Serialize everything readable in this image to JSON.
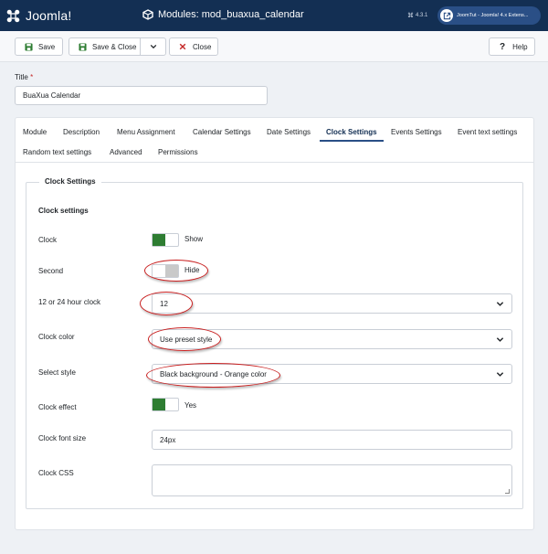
{
  "header": {
    "logo_text": "Joomla!",
    "page_title": "Modules: mod_buaxua_calendar",
    "version": "4.3.1",
    "version_symbol": "⌘",
    "site_link": "JoomTut - Joomla! 4.x Extens..."
  },
  "toolbar": {
    "save_label": "Save",
    "save_close_label": "Save & Close",
    "close_label": "Close",
    "help_label": "Help"
  },
  "title_field": {
    "label": "Title",
    "required_mark": "*",
    "value": "BuaXua Calendar"
  },
  "tabs": [
    "Module",
    "Description",
    "Menu Assignment",
    "Calendar Settings",
    "Date Settings",
    "Clock Settings",
    "Events Settings",
    "Event text settings",
    "Random text settings",
    "Advanced",
    "Permissions"
  ],
  "active_tab": "Clock Settings",
  "fieldset": {
    "legend": "Clock Settings",
    "heading": "Clock settings"
  },
  "fields": {
    "clock": {
      "label": "Clock",
      "state": "Show",
      "on": true
    },
    "second": {
      "label": "Second",
      "state": "Hide",
      "on": false
    },
    "hour_format": {
      "label": "12 or 24 hour clock",
      "value": "12"
    },
    "clock_color": {
      "label": "Clock color",
      "value": "Use preset style"
    },
    "select_style": {
      "label": "Select style",
      "value": "Black background - Orange color"
    },
    "clock_effect": {
      "label": "Clock effect",
      "state": "Yes",
      "on": true
    },
    "font_size": {
      "label": "Clock font size",
      "value": "24px"
    },
    "clock_css": {
      "label": "Clock CSS",
      "value": ""
    }
  },
  "colors": {
    "header_bg": "#132f53",
    "toggle_on": "#2e7d32",
    "toggle_off": "#c9c9c9",
    "annotation": "#c81e1e"
  }
}
